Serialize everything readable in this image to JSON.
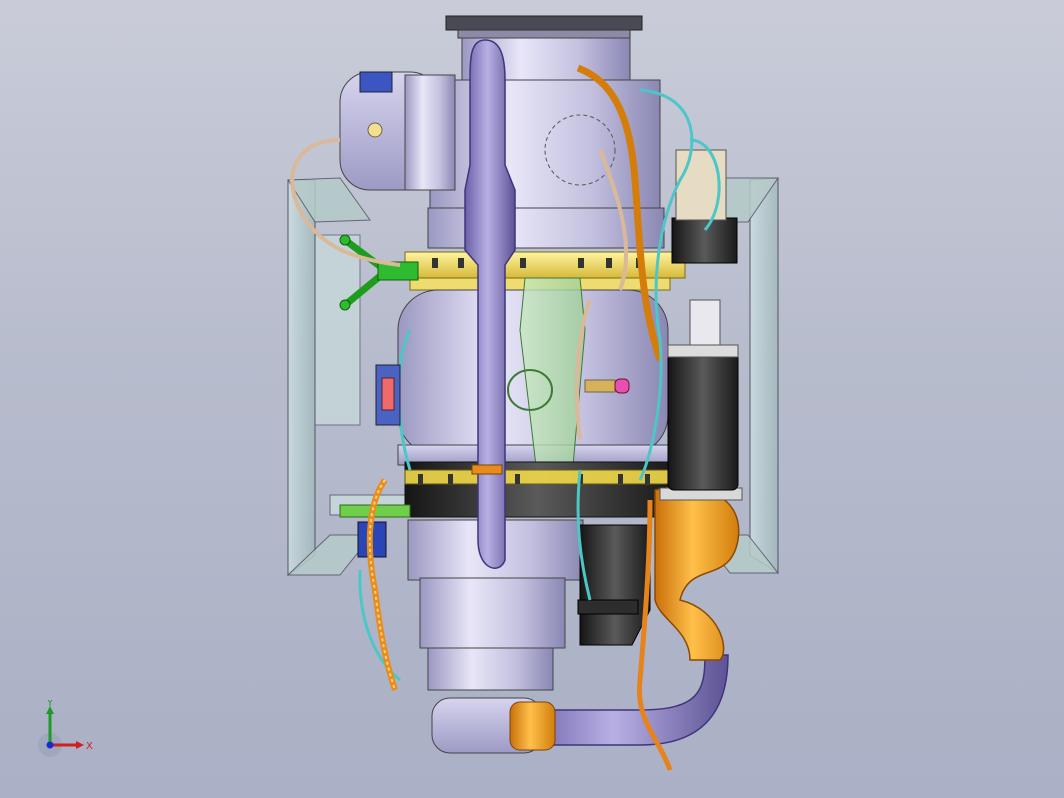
{
  "view": {
    "background_top": "#c9ccd8",
    "background_bottom": "#aab0c5"
  },
  "triad": {
    "x_label": "X",
    "y_label": "Y",
    "x_color": "#d21e1e",
    "y_color": "#1e9a2a",
    "z_color": "#1a2ad2"
  },
  "parts": [
    "frame",
    "top-flange",
    "cylindrical-housing",
    "electric-motor",
    "mounting-arm",
    "mounting-ring",
    "combustor-casing",
    "front-bracket",
    "exhaust-pipe-vertical",
    "lower-ring",
    "lower-casing",
    "lower-end-cap",
    "black-elbow",
    "orange-duct",
    "black-canister",
    "lilac-return-pipe",
    "orange-cable",
    "cyan-harness",
    "beige-cable",
    "green-clamp",
    "nameplate",
    "blue-connector",
    "side-valve"
  ]
}
